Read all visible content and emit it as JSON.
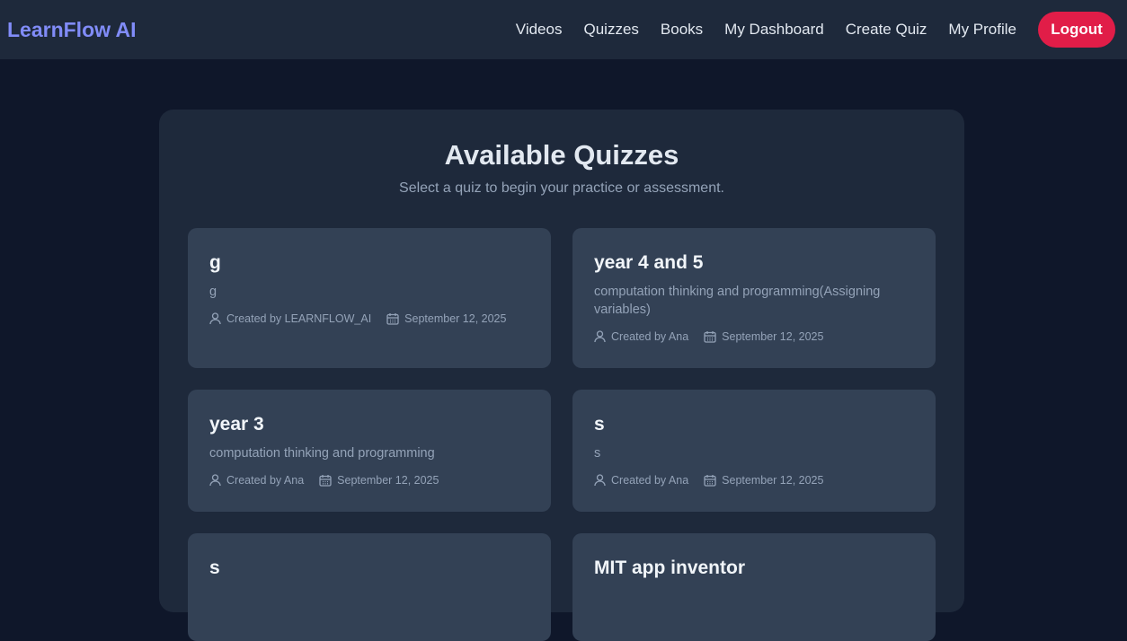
{
  "brand": "LearnFlow AI",
  "nav": {
    "videos": "Videos",
    "quizzes": "Quizzes",
    "books": "Books",
    "dashboard": "My Dashboard",
    "create_quiz": "Create Quiz",
    "profile": "My Profile",
    "logout": "Logout"
  },
  "colors": {
    "background": "#0f172a",
    "surface": "#1e293b",
    "card": "#334155",
    "brand": "#818cf8",
    "logout": "#e11d48"
  },
  "main": {
    "title": "Available Quizzes",
    "subtitle": "Select a quiz to begin your practice or assessment."
  },
  "quizzes": [
    {
      "title": "g",
      "description": "g",
      "creator": "Created by LEARNFLOW_AI",
      "date": "September 12, 2025"
    },
    {
      "title": "year 4 and 5",
      "description": "computation thinking and programming(Assigning variables)",
      "creator": "Created by Ana",
      "date": "September 12, 2025"
    },
    {
      "title": "year 3",
      "description": "computation thinking and programming",
      "creator": "Created by Ana",
      "date": "September 12, 2025"
    },
    {
      "title": "s",
      "description": "s",
      "creator": "Created by Ana",
      "date": "September 12, 2025"
    },
    {
      "title": "s"
    },
    {
      "title": "MIT app inventor"
    }
  ]
}
